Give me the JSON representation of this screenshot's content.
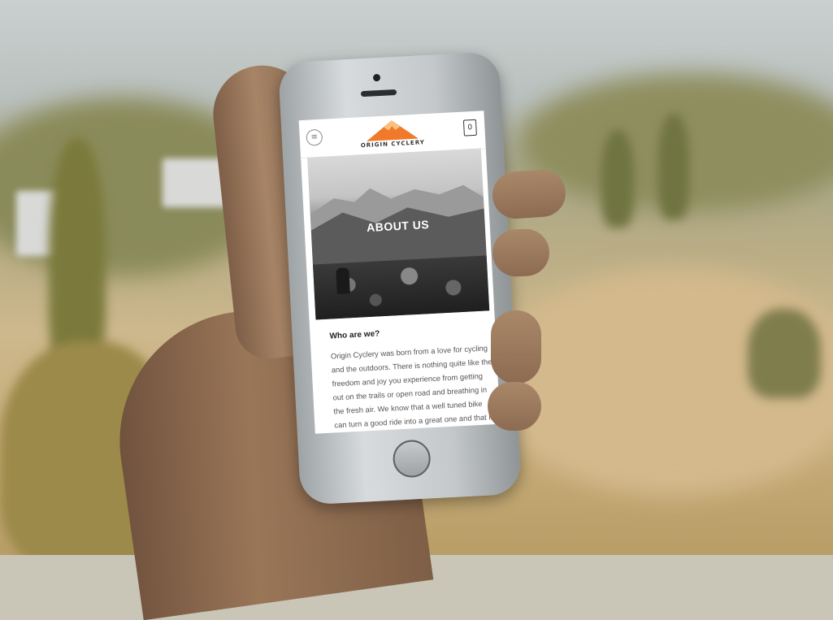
{
  "site": {
    "brand_name": "ORIGIN CYCLERY",
    "cart_count": "0",
    "menu_icon": "hamburger-menu-icon",
    "cart_icon": "shopping-bag-icon"
  },
  "hero": {
    "title": "ABOUT US"
  },
  "section": {
    "heading": "Who are we?",
    "body": "Origin Cyclery was born from a love for cycling and the outdoors. There is nothing quite like the freedom and joy you experience from getting out on the trails or open road and breathing in the fresh air. We know that a well tuned bike can turn a good ride into a great one and that is exactly what we aim to do. Origin"
  },
  "colors": {
    "logo_orange": "#f07a2a",
    "text": "#555555"
  }
}
